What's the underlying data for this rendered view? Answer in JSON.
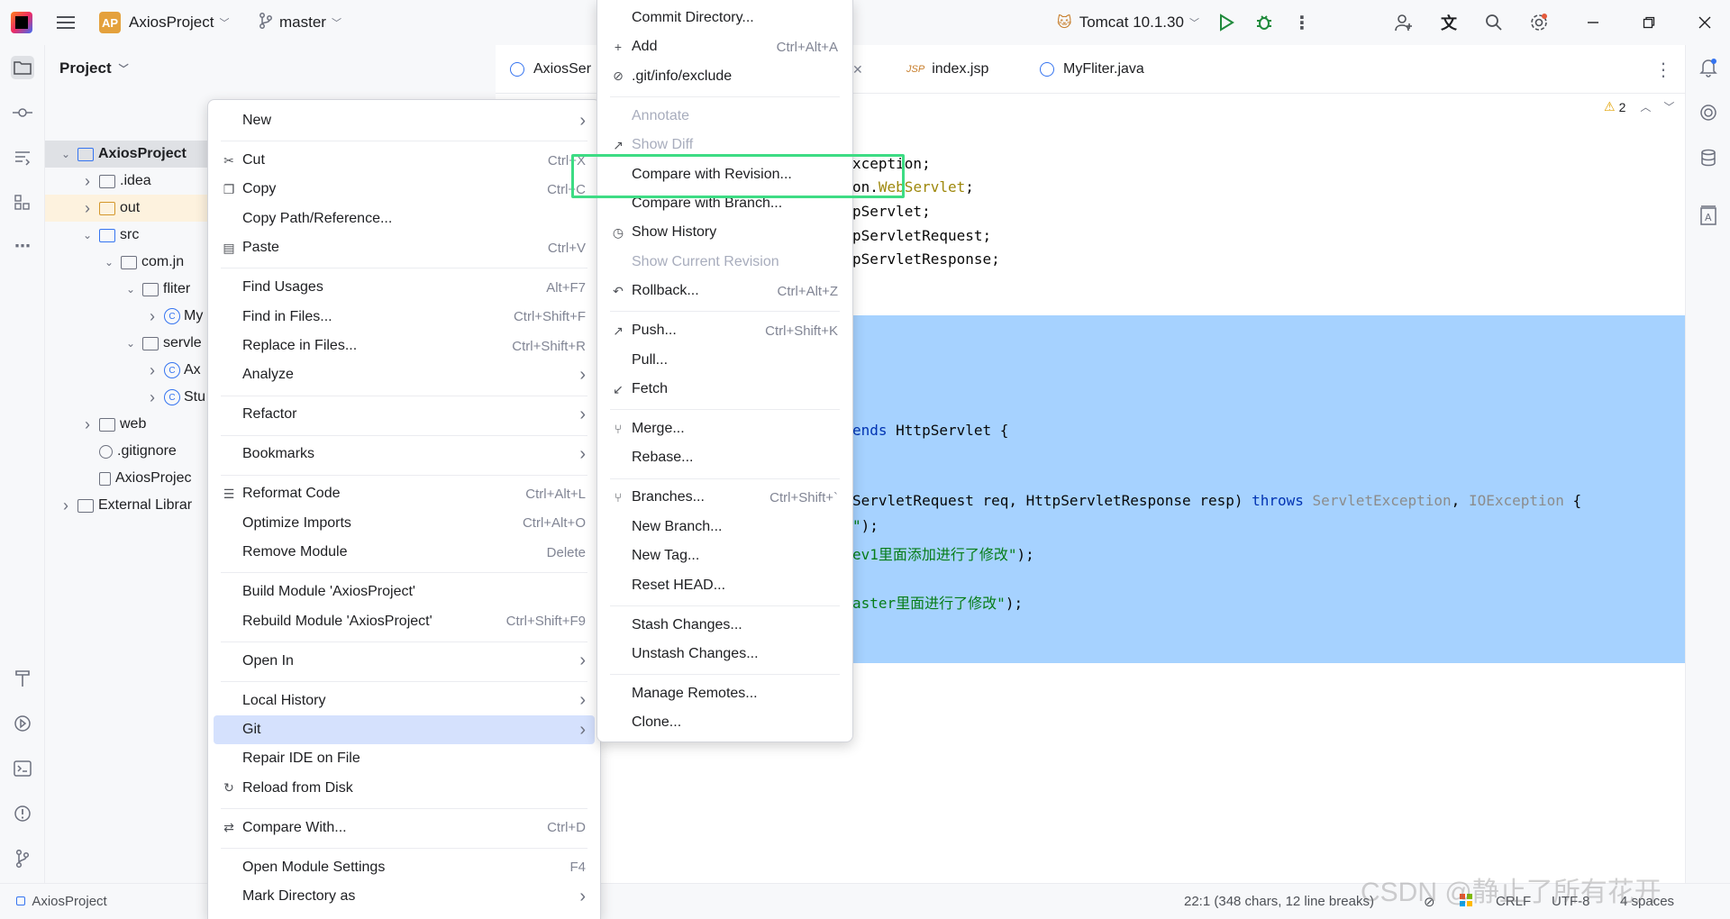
{
  "titlebar": {
    "project_badge": "AP",
    "project_name": "AxiosProject",
    "branch": "master",
    "run_config": "Tomcat 10.1.30"
  },
  "project_pane": {
    "title": "Project",
    "tree": [
      {
        "label": "AxiosProject",
        "depth": 0,
        "kind": "module",
        "expanded": true,
        "bold": true,
        "selected": true
      },
      {
        "label": ".idea",
        "depth": 1,
        "kind": "folder",
        "expanded": false
      },
      {
        "label": "out",
        "depth": 1,
        "kind": "folder-out",
        "expanded": false
      },
      {
        "label": "src",
        "depth": 1,
        "kind": "folder-src",
        "expanded": true
      },
      {
        "label": "com.jn",
        "depth": 2,
        "kind": "package",
        "expanded": true
      },
      {
        "label": "fliter",
        "depth": 3,
        "kind": "package",
        "expanded": true
      },
      {
        "label": "My",
        "depth": 4,
        "kind": "class",
        "expanded": false
      },
      {
        "label": "servle",
        "depth": 3,
        "kind": "package",
        "expanded": true
      },
      {
        "label": "Ax",
        "depth": 4,
        "kind": "class",
        "expanded": false
      },
      {
        "label": "Stu",
        "depth": 4,
        "kind": "class",
        "expanded": false
      },
      {
        "label": "web",
        "depth": 1,
        "kind": "folder",
        "expanded": false
      },
      {
        "label": ".gitignore",
        "depth": 1,
        "kind": "file-ignore",
        "expanded": null
      },
      {
        "label": "AxiosProjec",
        "depth": 1,
        "kind": "file",
        "expanded": null
      },
      {
        "label": "External Librar",
        "depth": 0,
        "kind": "library",
        "expanded": false
      }
    ]
  },
  "tabs": [
    {
      "label": "AxiosSer",
      "kind": "class"
    },
    {
      "label": "index.jsp",
      "kind": "jsp"
    },
    {
      "label": "MyFliter.java",
      "kind": "class"
    }
  ],
  "editor": {
    "warning_count": "2",
    "lines": [
      {
        "parts": [
          {
            "t": "xception;",
            "c": ""
          }
        ]
      },
      {
        "parts": [
          {
            "t": "on.",
            "c": ""
          },
          {
            "t": "WebServlet",
            "c": "cls"
          },
          {
            "t": ";",
            "c": ""
          }
        ]
      },
      {
        "parts": [
          {
            "t": "pServlet;",
            "c": ""
          }
        ]
      },
      {
        "parts": [
          {
            "t": "pServletRequest;",
            "c": ""
          }
        ]
      },
      {
        "parts": [
          {
            "t": "pServletResponse;",
            "c": ""
          }
        ]
      },
      {
        "parts": [
          {
            "t": "ends",
            "c": "kw"
          },
          {
            "t": " HttpServlet {",
            "c": ""
          }
        ]
      },
      {
        "parts": [
          {
            "t": "ServletRequest req, HttpServletResponse resp) ",
            "c": ""
          },
          {
            "t": "throws",
            "c": "kw"
          },
          {
            "t": " ",
            "c": ""
          },
          {
            "t": "ServletException",
            "c": "gray"
          },
          {
            "t": ", ",
            "c": ""
          },
          {
            "t": "IOException",
            "c": "gray"
          },
          {
            "t": " {",
            "c": ""
          }
        ]
      },
      {
        "parts": [
          {
            "t": "\"",
            "c": "str"
          },
          {
            "t": ");",
            "c": ""
          }
        ]
      },
      {
        "parts": [
          {
            "t": "ev1里面添加进行了修改\"",
            "c": "str"
          },
          {
            "t": ");",
            "c": ""
          }
        ]
      },
      {
        "parts": [
          {
            "t": "aster里面进行了修改\"",
            "c": "str"
          },
          {
            "t": ");",
            "c": ""
          }
        ]
      }
    ]
  },
  "context_menu": [
    {
      "label": "New",
      "shortcut": "",
      "submenu": true,
      "icon": ""
    },
    {
      "sep": true
    },
    {
      "label": "Cut",
      "shortcut": "Ctrl+X",
      "icon": "scissors-icon",
      "glyph": "✂"
    },
    {
      "label": "Copy",
      "shortcut": "Ctrl+C",
      "icon": "copy-icon",
      "glyph": "❐"
    },
    {
      "label": "Copy Path/Reference...",
      "shortcut": ""
    },
    {
      "label": "Paste",
      "shortcut": "Ctrl+V",
      "icon": "paste-icon",
      "glyph": "▤"
    },
    {
      "sep": true
    },
    {
      "label": "Find Usages",
      "shortcut": "Alt+F7"
    },
    {
      "label": "Find in Files...",
      "shortcut": "Ctrl+Shift+F"
    },
    {
      "label": "Replace in Files...",
      "shortcut": "Ctrl+Shift+R"
    },
    {
      "label": "Analyze",
      "submenu": true
    },
    {
      "sep": true
    },
    {
      "label": "Refactor",
      "submenu": true
    },
    {
      "sep": true
    },
    {
      "label": "Bookmarks",
      "submenu": true
    },
    {
      "sep": true
    },
    {
      "label": "Reformat Code",
      "shortcut": "Ctrl+Alt+L",
      "icon": "reformat-icon",
      "glyph": "☰"
    },
    {
      "label": "Optimize Imports",
      "shortcut": "Ctrl+Alt+O"
    },
    {
      "label": "Remove Module",
      "shortcut": "Delete"
    },
    {
      "sep": true
    },
    {
      "label": "Build Module 'AxiosProject'",
      "shortcut": ""
    },
    {
      "label": "Rebuild Module 'AxiosProject'",
      "shortcut": "Ctrl+Shift+F9"
    },
    {
      "sep": true
    },
    {
      "label": "Open In",
      "submenu": true
    },
    {
      "sep": true
    },
    {
      "label": "Local History",
      "submenu": true
    },
    {
      "label": "Git",
      "submenu": true,
      "hover": true
    },
    {
      "label": "Repair IDE on File",
      "shortcut": ""
    },
    {
      "label": "Reload from Disk",
      "shortcut": "",
      "icon": "reload-icon",
      "glyph": "↻"
    },
    {
      "sep": true
    },
    {
      "label": "Compare With...",
      "shortcut": "Ctrl+D",
      "icon": "compare-icon",
      "glyph": "⇄"
    },
    {
      "sep": true
    },
    {
      "label": "Open Module Settings",
      "shortcut": "F4"
    },
    {
      "label": "Mark Directory as",
      "submenu": true
    }
  ],
  "git_menu": [
    {
      "label": "Commit Directory...",
      "shortcut": ""
    },
    {
      "label": "Add",
      "shortcut": "Ctrl+Alt+A",
      "icon": "plus-icon",
      "glyph": "+"
    },
    {
      "label": ".git/info/exclude",
      "shortcut": "",
      "icon": "exclude-icon",
      "glyph": "⊘"
    },
    {
      "sep": true
    },
    {
      "label": "Annotate",
      "disabled": true
    },
    {
      "label": "Show Diff",
      "disabled": true,
      "icon": "diff-icon",
      "glyph": "↗"
    },
    {
      "label": "Compare with Revision...",
      "shortcut": ""
    },
    {
      "label": "Compare with Branch...",
      "shortcut": ""
    },
    {
      "label": "Show History",
      "shortcut": "",
      "icon": "history-icon",
      "glyph": "◷"
    },
    {
      "label": "Show Current Revision",
      "disabled": true
    },
    {
      "label": "Rollback...",
      "shortcut": "Ctrl+Alt+Z",
      "icon": "rollback-icon",
      "glyph": "↶"
    },
    {
      "sep": true
    },
    {
      "label": "Push...",
      "shortcut": "Ctrl+Shift+K",
      "icon": "push-icon",
      "glyph": "↗"
    },
    {
      "label": "Pull...",
      "shortcut": ""
    },
    {
      "label": "Fetch",
      "shortcut": "",
      "icon": "fetch-icon",
      "glyph": "↙"
    },
    {
      "sep": true
    },
    {
      "label": "Merge...",
      "shortcut": "",
      "icon": "merge-icon",
      "glyph": "⑂"
    },
    {
      "label": "Rebase...",
      "shortcut": ""
    },
    {
      "sep": true
    },
    {
      "label": "Branches...",
      "shortcut": "Ctrl+Shift+`",
      "icon": "branch-icon",
      "glyph": "⑂"
    },
    {
      "label": "New Branch...",
      "shortcut": ""
    },
    {
      "label": "New Tag...",
      "shortcut": ""
    },
    {
      "label": "Reset HEAD...",
      "shortcut": ""
    },
    {
      "sep": true
    },
    {
      "label": "Stash Changes...",
      "shortcut": ""
    },
    {
      "label": "Unstash Changes...",
      "shortcut": ""
    },
    {
      "sep": true
    },
    {
      "label": "Manage Remotes...",
      "shortcut": ""
    },
    {
      "label": "Clone...",
      "shortcut": ""
    }
  ],
  "statusbar": {
    "project": "AxiosProject",
    "position": "22:1 (348 chars, 12 line breaks)",
    "line_sep": "CRLF",
    "encoding": "UTF-8",
    "indent": "4 spaces"
  },
  "watermark": "CSDN @静止了所有花开"
}
